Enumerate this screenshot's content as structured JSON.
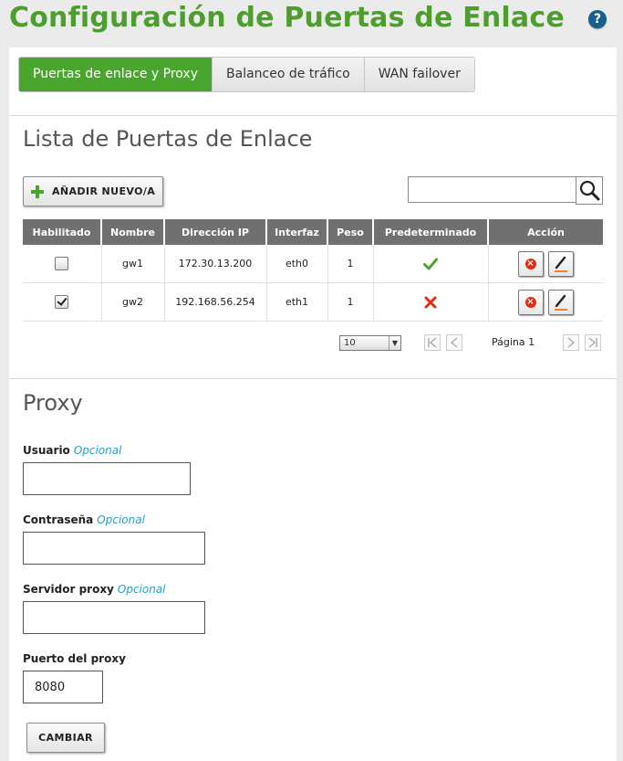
{
  "page": {
    "title": "Configuración de Puertas de Enlace",
    "help_icon": "?"
  },
  "tabs": [
    {
      "label": "Puertas de enlace y Proxy",
      "active": true
    },
    {
      "label": "Balanceo de tráfico",
      "active": false
    },
    {
      "label": "WAN failover",
      "active": false
    }
  ],
  "gateways": {
    "title": "Lista de Puertas de Enlace",
    "add_button": "AÑADIR NUEVO/A",
    "search_value": "",
    "columns": [
      "Habilitado",
      "Nombre",
      "Dirección IP",
      "Interfaz",
      "Peso",
      "Predeterminado",
      "Acción"
    ],
    "rows": [
      {
        "enabled": false,
        "name": "gw1",
        "ip": "172.30.13.200",
        "interface": "eth0",
        "weight": "1",
        "default": true
      },
      {
        "enabled": true,
        "name": "gw2",
        "ip": "192.168.56.254",
        "interface": "eth1",
        "weight": "1",
        "default": false
      }
    ],
    "page_size": "10",
    "page_label": "Página 1"
  },
  "proxy": {
    "title": "Proxy",
    "optional_label": "Opcional",
    "fields": {
      "user": {
        "label": "Usuario",
        "value": ""
      },
      "password": {
        "label": "Contraseña",
        "value": ""
      },
      "server": {
        "label": "Servidor proxy",
        "value": ""
      },
      "port": {
        "label": "Puerto del proxy",
        "value": "8080"
      }
    },
    "submit": "CAMBIAR"
  },
  "colors": {
    "accent": "#4d9d2f",
    "tab_active": "#4aa52e",
    "optional": "#2aa0c8",
    "header": "#707070",
    "delete": "#e02e13"
  }
}
